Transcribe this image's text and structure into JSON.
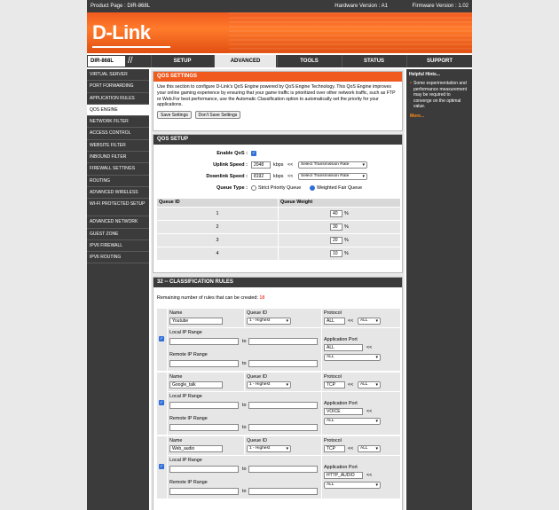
{
  "topbar": {
    "product_page": "Product Page : DIR-868L",
    "hardware_version": "Hardware Version : A1",
    "firmware_version": "Firmware Version : 1.02"
  },
  "brand": {
    "logo_text": "D-Link",
    "accent_color": "#f05a1e",
    "dark_color": "#3b3b3b"
  },
  "nav": {
    "model": "DIR-868L",
    "tabs": [
      "SETUP",
      "ADVANCED",
      "TOOLS",
      "STATUS",
      "SUPPORT"
    ],
    "active_tab": "ADVANCED"
  },
  "sidebar": {
    "items": [
      "VIRTUAL SERVER",
      "PORT FORWARDING",
      "APPLICATION RULES",
      "QOS ENGINE",
      "NETWORK FILTER",
      "ACCESS CONTROL",
      "WEBSITE FILTER",
      "INBOUND FILTER",
      "FIREWALL SETTINGS",
      "ROUTING",
      "ADVANCED WIRELESS",
      "WI-FI PROTECTED SETUP",
      "ADVANCED NETWORK",
      "GUEST ZONE",
      "IPV6 FIREWALL",
      "IPV6 ROUTING"
    ],
    "active_item": "QOS ENGINE"
  },
  "hints": {
    "title": "Helpful Hints...",
    "items": [
      "Some experimentation and performance measurement may be required to converge on the optimal value."
    ],
    "more": "More..."
  },
  "qos_settings": {
    "title": "QOS SETTINGS",
    "description": "Use this section to configure D-Link's QoS Engine powered by QoS Engine Technology. This QoS Engine improves your online gaming experience by ensuring that your game traffic is prioritized over other network traffic, such as FTP or Web.For best performance, use the Automatic Classification option to automatically set the priority for your applications.",
    "save_label": "Save Settings",
    "dont_save_label": "Don't Save Settings"
  },
  "qos_setup": {
    "title": "QOS SETUP",
    "enable_label": "Enable QoS :",
    "enable_checked": true,
    "uplink_label": "Uplink Speed :",
    "uplink_value": "2048",
    "downlink_label": "Downlink Speed :",
    "downlink_value": "8192",
    "unit": "kbps",
    "arrow": "<<",
    "rate_select": "Select Transmission Rate",
    "queue_type_label": "Queue Type :",
    "queue_type_options": [
      "Strict Priority Queue",
      "Weighted Fair Queue"
    ],
    "queue_type_selected": "Weighted Fair Queue",
    "queue_id_header": "Queue ID",
    "queue_weight_header": "Queue Weight",
    "queues": [
      {
        "id": "1",
        "weight": "40"
      },
      {
        "id": "2",
        "weight": "30"
      },
      {
        "id": "3",
        "weight": "20"
      },
      {
        "id": "4",
        "weight": "10"
      }
    ],
    "percent": "%"
  },
  "classification": {
    "title": "32 -- CLASSIFICATION RULES",
    "remaining_label": "Remaining number of rules that can be created:",
    "remaining_value": "18",
    "labels": {
      "name": "Name",
      "queue_id": "Queue ID",
      "protocol": "Protocol",
      "local_ip": "Local IP Range",
      "remote_ip": "Remote IP Range",
      "app_port": "Application Port",
      "to": "to",
      "arrow": "<<"
    },
    "rules": [
      {
        "checked": true,
        "name": "Youtube",
        "queue": "1 - Highest",
        "protocol": "ALL",
        "protocol_select": "ALL",
        "app_port": "ALL",
        "app_port_select": "ALL"
      },
      {
        "checked": true,
        "name": "Google_talk",
        "queue": "1 - Highest",
        "protocol": "TCP",
        "protocol_select": "ALL",
        "app_port": "VOICE",
        "app_port_select": "ALL"
      },
      {
        "checked": true,
        "name": "Web_audio",
        "queue": "1 - Highest",
        "protocol": "TCP",
        "protocol_select": "ALL",
        "app_port": "HTTP_AUDIO",
        "app_port_select": "ALL"
      }
    ]
  }
}
